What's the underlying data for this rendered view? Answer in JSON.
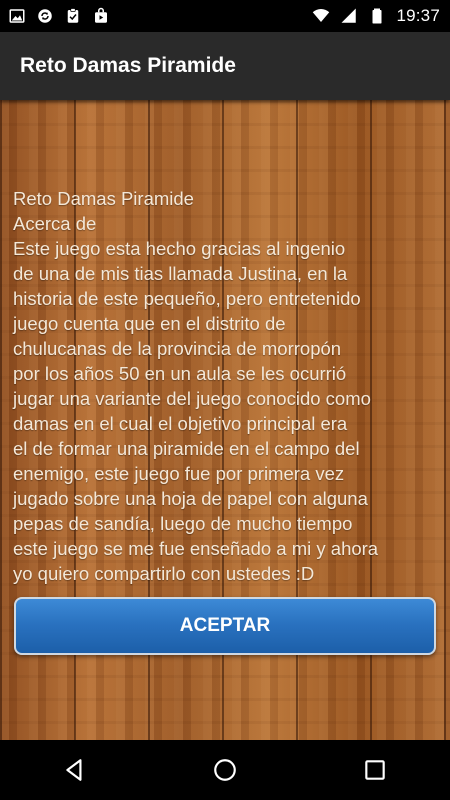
{
  "status_bar": {
    "time": "19:37",
    "left_icons": [
      "image-icon",
      "sync-icon",
      "clipboard-check-icon",
      "shopping-bag-icon"
    ],
    "right_icons": [
      "wifi-icon",
      "signal-icon",
      "battery-icon"
    ]
  },
  "app_bar": {
    "title": "Reto Damas Piramide"
  },
  "content": {
    "heading": "Reto Damas Piramide",
    "subheading": "Acerca de",
    "body": "Este juego esta hecho gracias al ingenio\nde una de mis tias llamada Justina, en la\nhistoria de este pequeño, pero entretenido\njuego cuenta que en el distrito de\nchulucanas de la provincia de morropón\npor los años 50 en un aula se les ocurrió\njugar una variante del juego conocido como\ndamas en el cual el objetivo principal era\nel de formar una piramide en el campo del\nenemigo, este juego fue por primera vez\njugado sobre una hoja de papel con alguna\npepas de sandía, luego de mucho tiempo\neste juego se me fue enseñado a mi y ahora\nyo quiero compartirlo con ustedes :D"
  },
  "accept_button": {
    "label": "ACEPTAR"
  },
  "nav_bar": {
    "icons": [
      "back-icon",
      "home-icon",
      "recents-icon"
    ]
  },
  "colors": {
    "app_bar": "#2a2a2a",
    "button": "#2a72c0",
    "wood": "#a8642f",
    "text": "#f4e8d8"
  }
}
